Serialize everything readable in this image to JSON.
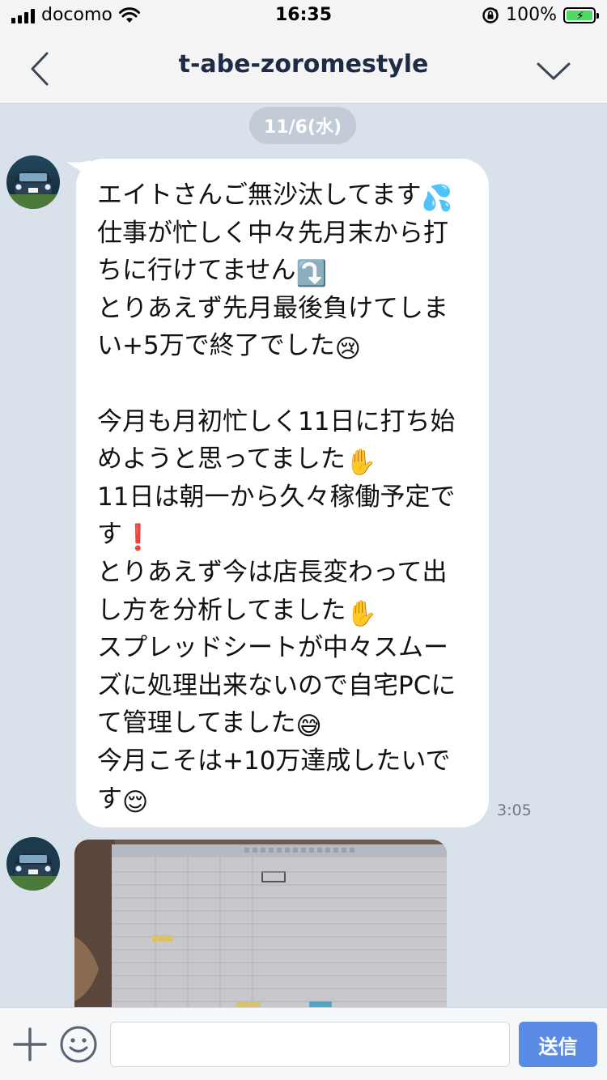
{
  "status_bar": {
    "carrier": "docomo",
    "time": "16:35",
    "battery": "100%"
  },
  "nav": {
    "title": "t-abe-zoromestyle"
  },
  "chat": {
    "date_label": "11/6(水)",
    "message": {
      "lines": [
        {
          "text": "エイトさんご無沙汰してます",
          "emoji": "💦"
        },
        {
          "text": "仕事が忙しく中々先月末から打",
          "emoji": ""
        },
        {
          "text": "ちに行けてません",
          "emoji": "⤵️"
        },
        {
          "text": "とりあえず先月最後負けてしま",
          "emoji": ""
        },
        {
          "text": "い+5万で終了でした",
          "emoji": "😢"
        },
        {
          "text": "",
          "emoji": ""
        },
        {
          "text": "今月も月初忙しく11日に打ち始",
          "emoji": ""
        },
        {
          "text": "めようと思ってました",
          "emoji": "✋"
        },
        {
          "text": "11日は朝一から久々稼働予定で",
          "emoji": ""
        },
        {
          "text": "す",
          "emoji": "❗"
        },
        {
          "text": "とりあえず今は店長変わって出",
          "emoji": ""
        },
        {
          "text": "し方を分析してました",
          "emoji": "✋"
        },
        {
          "text": "スプレッドシートが中々スムー",
          "emoji": ""
        },
        {
          "text": "ズに処理出来ないので自宅PCに",
          "emoji": ""
        },
        {
          "text": "て管理してました",
          "emoji": "😅"
        },
        {
          "text": "今月こそは+10万達成したいで",
          "emoji": ""
        },
        {
          "text": "す",
          "emoji": "😌"
        }
      ],
      "timestamp": "3:05"
    }
  },
  "input_bar": {
    "placeholder": "",
    "send_label": "送信"
  },
  "colors": {
    "chat_background": "#d9e1ea",
    "send_button": "#5a8ce6",
    "bubble": "#ffffff",
    "date_pill": "#c3cbd6"
  }
}
